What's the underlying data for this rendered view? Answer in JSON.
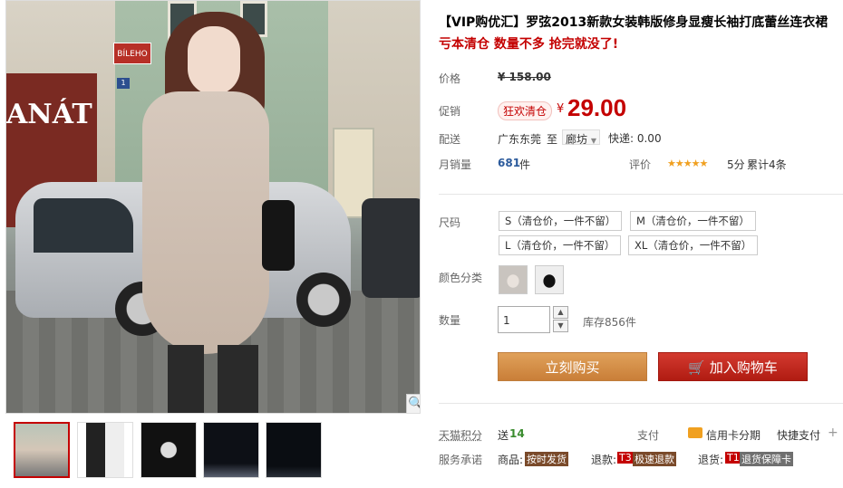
{
  "gallery": {
    "shop_sign": "ANÁT",
    "street_sign": "BÍLEHO",
    "street_number": "1",
    "zoom_icon": "magnifier-icon",
    "thumbnails": [
      "thumb-1",
      "thumb-2",
      "thumb-3",
      "thumb-4",
      "thumb-5"
    ],
    "selected_thumbnail": 0
  },
  "product": {
    "title": "【VIP购优汇】罗弦2013新款女装韩版修身显瘦长袖打底蕾丝连衣裙",
    "subtitle": "亏本清仓 数量不多 抢完就没了!",
    "price_label": "价格",
    "price_original": "¥ 158.00",
    "promo_label": "促销",
    "promo_tag": "狂欢清仓",
    "currency": "¥",
    "promo_price": "29.00",
    "ship_label": "配送",
    "ship_from": "广东东莞",
    "ship_to_word": "至",
    "ship_to": "廊坊",
    "express": "快递: 0.00",
    "sales_label": "月销量",
    "sales_count": "681",
    "sales_unit": "件",
    "rating_label": "评价",
    "rating_stars": "★★★★★",
    "rating_score": "5分",
    "rating_count": "累计4条"
  },
  "options": {
    "size_label": "尺码",
    "sizes": [
      "S（清仓价，一件不留）",
      "M（清仓价，一件不留）",
      "L（清仓价，一件不留）",
      "XL（清仓价，一件不留）"
    ],
    "color_label": "颜色分类",
    "qty_label": "数量",
    "qty_value": "1",
    "stock": "库存856件"
  },
  "actions": {
    "buy_now": "立刻购买",
    "add_cart": "加入购物车",
    "cart_icon": "cart-icon"
  },
  "footer": {
    "points_label": "天猫积分",
    "points_prefix": "送",
    "points_value": "14",
    "pay_label": "支付",
    "credit_pay": "信用卡分期",
    "quick_pay": "快捷支付",
    "more": "+",
    "service_label": "服务承诺",
    "goods_label": "商品:",
    "goods_badge": "按时发货",
    "refund_label": "退款:",
    "refund_code": "T3",
    "refund_badge": "极速退款",
    "return_label": "退货:",
    "return_code": "T1",
    "return_badge": "退货保障卡"
  },
  "colors": {
    "accent_red": "#c40000",
    "buy_button": "#d08a42",
    "cart_button": "#c1241a",
    "points_green": "#3a8c2e"
  }
}
